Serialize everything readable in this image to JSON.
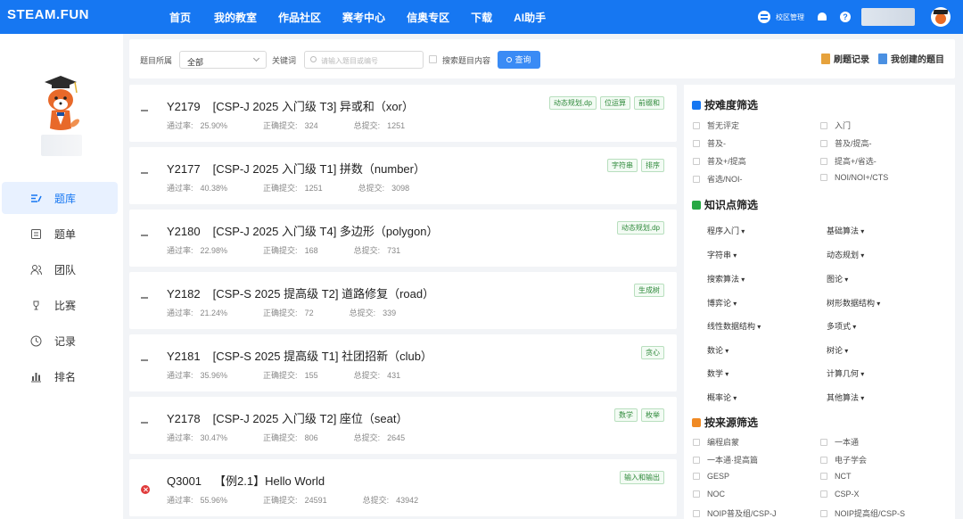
{
  "topbar": {
    "logo": "STEAM.FUN",
    "nav": [
      "首页",
      "我的教室",
      "作品社区",
      "赛考中心",
      "信奥专区",
      "下载",
      "AI助手"
    ],
    "campus_label": "校区管理",
    "help_glyph": "?"
  },
  "sidebar": {
    "items": [
      {
        "label": "题库",
        "icon": "question-bank-icon",
        "active": true
      },
      {
        "label": "题单",
        "icon": "list-icon",
        "active": false
      },
      {
        "label": "团队",
        "icon": "team-icon",
        "active": false
      },
      {
        "label": "比赛",
        "icon": "trophy-icon",
        "active": false
      },
      {
        "label": "记录",
        "icon": "clock-icon",
        "active": false
      },
      {
        "label": "排名",
        "icon": "ranking-icon",
        "active": false
      }
    ]
  },
  "filterbar": {
    "category_label": "题目所属",
    "category_value": "全部",
    "keyword_label": "关键词",
    "search_placeholder": "请输入题目或编号",
    "search_content_label": "搜索题目内容",
    "query_button": "查询",
    "records_link": "刷题记录",
    "my_created_link": "我创建的题目"
  },
  "stat_labels": {
    "pass_rate": "通过率:",
    "correct": "正确提交:",
    "total": "总提交:"
  },
  "problems": [
    {
      "id": "Y2179",
      "title": "[CSP-J 2025 入门级 T3] 异或和（xor）",
      "pass_rate": "25.90%",
      "correct": "324",
      "total": "1251",
      "tags": [
        "动态规划,dp",
        "位运算",
        "前缀和"
      ],
      "status": "none"
    },
    {
      "id": "Y2177",
      "title": "[CSP-J 2025 入门级 T1] 拼数（number）",
      "pass_rate": "40.38%",
      "correct": "1251",
      "total": "3098",
      "tags": [
        "字符串",
        "排序"
      ],
      "status": "none"
    },
    {
      "id": "Y2180",
      "title": "[CSP-J 2025 入门级 T4] 多边形（polygon）",
      "pass_rate": "22.98%",
      "correct": "168",
      "total": "731",
      "tags": [
        "动态规划,dp"
      ],
      "status": "none"
    },
    {
      "id": "Y2182",
      "title": "[CSP-S 2025 提高级 T2] 道路修复（road）",
      "pass_rate": "21.24%",
      "correct": "72",
      "total": "339",
      "tags": [
        "生成树"
      ],
      "status": "none"
    },
    {
      "id": "Y2181",
      "title": "[CSP-S 2025 提高级 T1] 社团招新（club）",
      "pass_rate": "35.96%",
      "correct": "155",
      "total": "431",
      "tags": [
        "贪心"
      ],
      "status": "none"
    },
    {
      "id": "Y2178",
      "title": "[CSP-J 2025 入门级 T2] 座位（seat）",
      "pass_rate": "30.47%",
      "correct": "806",
      "total": "2645",
      "tags": [
        "数学",
        "枚举"
      ],
      "status": "none"
    },
    {
      "id": "Q3001",
      "title": "【例2.1】Hello World",
      "pass_rate": "55.96%",
      "correct": "24591",
      "total": "43942",
      "tags": [
        "输入和输出"
      ],
      "status": "wrong"
    }
  ],
  "right_panel": {
    "difficulty_title": "按难度筛选",
    "difficulty_options": [
      "暂无评定",
      "入门",
      "普及-",
      "普及/提高-",
      "普及+/提高",
      "提高+/省选-",
      "省选/NOI-",
      "NOI/NOI+/CTS"
    ],
    "knowledge_title": "知识点筛选",
    "knowledge_points": [
      "程序入门",
      "基础算法",
      "字符串",
      "动态规划",
      "搜索算法",
      "图论",
      "博弈论",
      "树形数据结构",
      "线性数据结构",
      "多项式",
      "数论",
      "树论",
      "数学",
      "计算几何",
      "概率论",
      "其他算法"
    ],
    "source_title": "按来源筛选",
    "source_options": [
      "编程启蒙",
      "一本通",
      "一本通·提高篇",
      "电子学会",
      "GESP",
      "NCT",
      "NOC",
      "CSP-X",
      "NOIP普及组/CSP-J",
      "NOIP提高组/CSP-S"
    ]
  },
  "colors": {
    "brand": "#1677f2",
    "tag_green": "#2f8a3b",
    "wrong_red": "#e03a3a"
  }
}
